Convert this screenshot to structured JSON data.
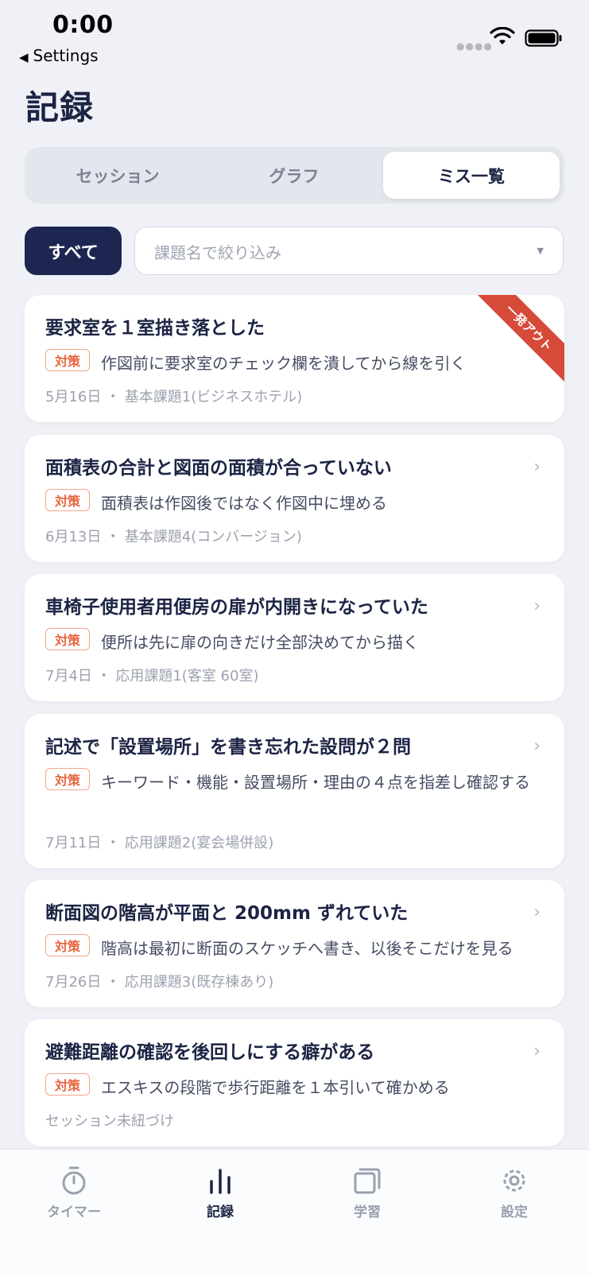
{
  "status_bar": {
    "time": "0:00",
    "back_label": "Settings"
  },
  "page_title": "記録",
  "segments": [
    {
      "label": "セッション",
      "active": false
    },
    {
      "label": "グラフ",
      "active": false
    },
    {
      "label": "ミス一覧",
      "active": true
    }
  ],
  "filter": {
    "all_label": "すべて",
    "select_placeholder": "課題名で絞り込み",
    "caret": "▼"
  },
  "measure_tag": "対策",
  "mistakes": [
    {
      "title": "要求室を１室描き落とした",
      "measure": "作図前に要求室のチェック欄を潰してから線を引く",
      "meta": "5月16日 ・ 基本課題1(ビジネスホテル)",
      "ribbon": "一発アウト"
    },
    {
      "title": "面積表の合計と図面の面積が合っていない",
      "measure": "面積表は作図後ではなく作図中に埋める",
      "meta": "6月13日 ・ 基本課題4(コンバージョン)"
    },
    {
      "title": "車椅子使用者用便房の扉が内開きになっていた",
      "measure": "便所は先に扉の向きだけ全部決めてから描く",
      "meta": "7月4日 ・ 応用課題1(客室 60室)"
    },
    {
      "title": "記述で「設置場所」を書き忘れた設問が２問",
      "measure": "キーワード・機能・設置場所・理由の４点を指差し確認する",
      "meta": "7月11日 ・ 応用課題2(宴会場併設)"
    },
    {
      "title": "断面図の階高が平面と 200mm ずれていた",
      "measure": "階高は最初に断面のスケッチへ書き、以後そこだけを見る",
      "meta": "7月26日 ・ 応用課題3(既存棟あり)"
    },
    {
      "title": "避難距離の確認を後回しにする癖がある",
      "measure": "エスキスの段階で歩行距離を１本引いて確かめる",
      "meta": "セッション未紐づけ"
    }
  ],
  "tabs": [
    {
      "label": "タイマー",
      "icon": "timer-icon",
      "active": false
    },
    {
      "label": "記録",
      "icon": "bar-chart-icon",
      "active": true
    },
    {
      "label": "学習",
      "icon": "cards-icon",
      "active": false
    },
    {
      "label": "設定",
      "icon": "gear-icon",
      "active": false
    }
  ],
  "colors": {
    "primary": "#1c2650",
    "accent": "#e9643f",
    "ribbon": "#d64a3a",
    "background": "#eff1f6"
  }
}
